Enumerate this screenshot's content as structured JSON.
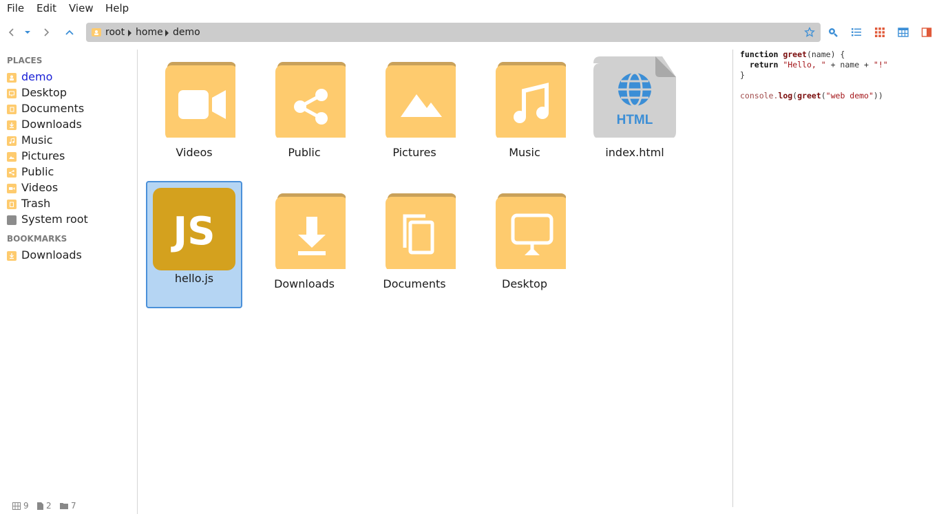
{
  "menubar": {
    "items": [
      "File",
      "Edit",
      "View",
      "Help"
    ]
  },
  "path": {
    "segments": [
      "root",
      "home",
      "demo"
    ]
  },
  "sidebar": {
    "places_heading": "PLACES",
    "places": [
      {
        "label": "demo",
        "icon": "home-folder-icon",
        "active": true
      },
      {
        "label": "Desktop",
        "icon": "desktop-folder-icon"
      },
      {
        "label": "Documents",
        "icon": "documents-folder-icon"
      },
      {
        "label": "Downloads",
        "icon": "downloads-folder-icon"
      },
      {
        "label": "Music",
        "icon": "music-folder-icon"
      },
      {
        "label": "Pictures",
        "icon": "pictures-folder-icon"
      },
      {
        "label": "Public",
        "icon": "public-folder-icon"
      },
      {
        "label": "Videos",
        "icon": "videos-folder-icon"
      },
      {
        "label": "Trash",
        "icon": "trash-icon"
      },
      {
        "label": "System root",
        "icon": "drive-icon"
      }
    ],
    "bookmarks_heading": "BOOKMARKS",
    "bookmarks": [
      {
        "label": "Downloads",
        "icon": "downloads-folder-icon"
      }
    ]
  },
  "status": {
    "items": "9",
    "files": "2",
    "folders": "7"
  },
  "files": [
    {
      "name": "Videos",
      "icon": "videos-folder-icon"
    },
    {
      "name": "Public",
      "icon": "public-folder-icon"
    },
    {
      "name": "Pictures",
      "icon": "pictures-folder-icon"
    },
    {
      "name": "Music",
      "icon": "music-folder-icon"
    },
    {
      "name": "index.html",
      "icon": "html-file-icon",
      "badge": "HTML"
    },
    {
      "name": "hello.js",
      "icon": "javascript-file-icon",
      "badge": "JS",
      "selected": true
    },
    {
      "name": "Downloads",
      "icon": "downloads-folder-icon"
    },
    {
      "name": "Documents",
      "icon": "documents-folder-icon"
    },
    {
      "name": "Desktop",
      "icon": "desktop-folder-icon"
    }
  ],
  "preview": {
    "code": {
      "kw_function": "function",
      "fn_greet": "greet",
      "params": "(name) {",
      "kw_return": "return",
      "str_hello": "\"Hello, \"",
      "concat1": " + name + ",
      "str_bang": "\"!\"",
      "close_brace": "}",
      "obj_console": "console.",
      "fn_log": "log",
      "paren_open": "(",
      "fn_greet2": "greet",
      "paren_open2": "(",
      "str_arg": "\"web demo\"",
      "paren_close": "))"
    }
  },
  "colors": {
    "folder": "#fecb6e",
    "folder_tab": "#c9a15a",
    "js_badge": "#d4a11e",
    "accent": "#3b8ed6",
    "selection": "#b5d5f3"
  }
}
